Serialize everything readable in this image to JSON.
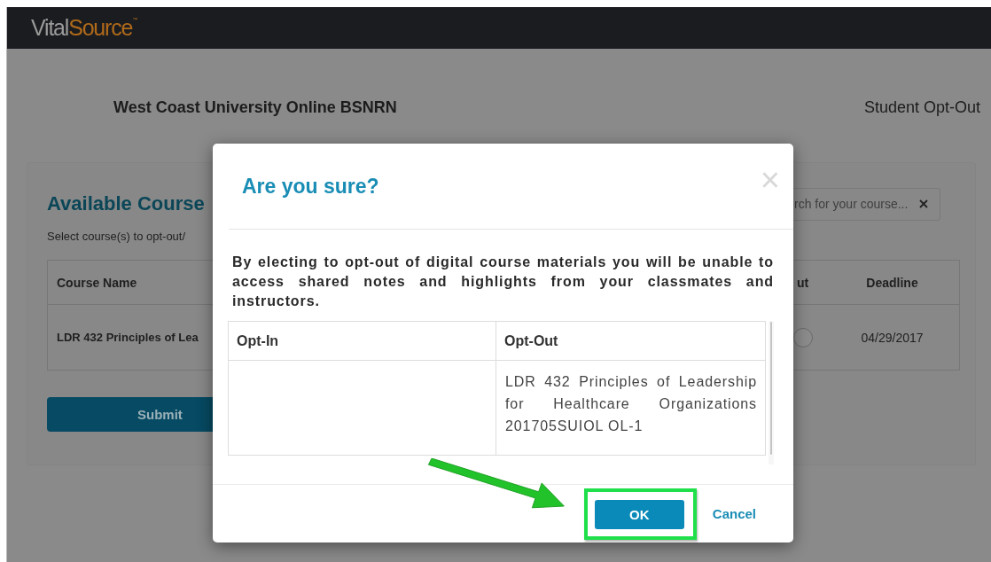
{
  "header": {
    "logo": {
      "first": "Vital",
      "second": "Source",
      "mark": "™"
    }
  },
  "page": {
    "institution": "West Coast University Online BSNRN",
    "page_title": "Student Opt-Out"
  },
  "courses_panel": {
    "heading": "Available Course",
    "search": {
      "placeholder": "rch for your course..."
    },
    "instructions": "Select course(s) to opt-out/",
    "table": {
      "columns": {
        "course": "Course Name",
        "column_3": "ut",
        "deadline": "Deadline"
      },
      "rows": [
        {
          "course": "LDR 432 Principles of Lea",
          "selected": false,
          "deadline": "04/29/2017"
        }
      ]
    },
    "submit": "Submit"
  },
  "dialog": {
    "title": "Are you sure?",
    "close": "×",
    "message": "By electing to opt-out of digital course materials you will be unable to access shared notes and highlights from your classmates and instructors.",
    "table": {
      "columns": {
        "opt_in": "Opt-In",
        "opt_out": "Opt-Out"
      },
      "rows": [
        {
          "opt_out": "LDR 432 Principles of Leadership for Healthcare Organizations 201705SUIOL OL-1"
        }
      ]
    },
    "buttons": [
      {
        "label": "OK",
        "kind": "primary"
      },
      {
        "label": "Cancel",
        "kind": "link"
      }
    ]
  }
}
